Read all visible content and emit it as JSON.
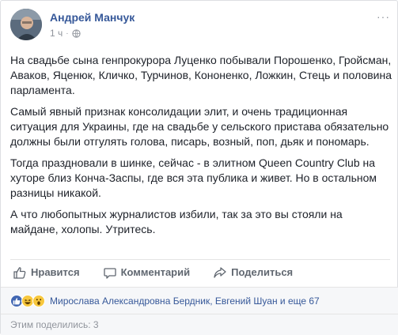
{
  "post": {
    "author": "Андрей Манчук",
    "time": "1 ч",
    "dot": "·",
    "menu": "···",
    "paragraphs": [
      "На свадьбе сына генпрокурора Луценко побывали Порошенко, Гройсман, Аваков, Яценюк, Кличко, Турчинов, Кононенко, Ложкин, Стець и половина парламента.",
      "Самый явный признак консолидации элит, и очень традиционная ситуация для Украины, где на свадьбе у сельского пристава обязательно должны были отгулять голова, писарь, возный, поп, дьяк и пономарь.",
      "Тогда праздновали в шинке, сейчас - в элитном Queen Country Club на хуторе близ Конча-Заспы, где вся эта публика и живет. Но в остальном разницы никакой.",
      "А что любопытных журналистов избили, так за это вы стояли на майдане, холопы. Утритесь."
    ]
  },
  "actions": {
    "like": "Нравится",
    "comment": "Комментарий",
    "share": "Поделиться"
  },
  "reactions": {
    "icons": [
      "like-reaction-icon",
      "haha-reaction-icon",
      "wow-reaction-icon"
    ],
    "likers": "Мирослава Александровна Бердник, Евгений Шуан и еще 67"
  },
  "shares": {
    "text": "Этим поделились: 3"
  },
  "colors": {
    "link": "#365899",
    "text": "#1d2129",
    "muted": "#90949c",
    "like_blue": "#4267b2",
    "reaction_yellow": "#f7c73d"
  }
}
